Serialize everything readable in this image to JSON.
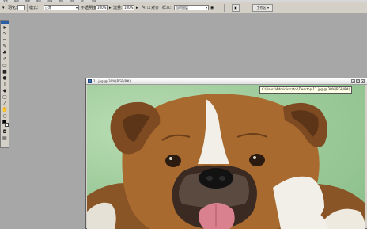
{
  "menubar": {
    "items": [
      "文件",
      "编辑",
      "图像",
      "图层",
      "选择",
      "滤镜",
      "视图",
      "窗口",
      "帮助"
    ]
  },
  "options": {
    "feather_label": "羽化:",
    "feather_value": "",
    "mode_label": "模式:",
    "mode_value": "正常",
    "opacity_label": "不透明度:",
    "opacity_value": "100%",
    "flow_label": "流量:",
    "flow_value": "100%",
    "align_label": "对齐",
    "sample_label": "样本:",
    "sample_value": "当前图层",
    "workspace_label": "工作区"
  },
  "toolbox": {
    "tools": [
      "move",
      "lasso",
      "brush",
      "stamp",
      "eraser",
      "gradient",
      "dodge",
      "pen",
      "text",
      "path",
      "shape",
      "eyedropper",
      "hand",
      "zoom",
      "mask",
      "screen"
    ]
  },
  "document": {
    "title": "11.jpg @ 30%(RGB/8#)"
  },
  "tooltip": {
    "text": "C:\\Users\\Administrator\\Desktop\\11.jpg @ 30%(RGB/8#)"
  },
  "colors": {
    "workspace": "#a7a7a7",
    "panel": "#d4d0c8",
    "canvas_bg": "#9fcc9c",
    "fur_brown": "#a86a2e",
    "fur_white": "#f1efe8",
    "tongue": "#d9818f"
  }
}
